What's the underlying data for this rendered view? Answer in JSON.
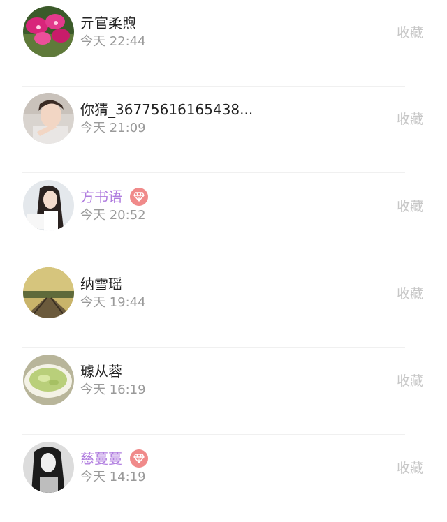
{
  "rows": [
    {
      "name": "亓官柔煦",
      "time": "今天 22:44",
      "action": "收藏",
      "vip": false,
      "avatar_icon": "orchid-flower-avatar"
    },
    {
      "name": "你猜_36775616165438...",
      "time": "今天 21:09",
      "action": "收藏",
      "vip": false,
      "avatar_icon": "young-man-avatar"
    },
    {
      "name": "方书语",
      "time": "今天 20:52",
      "action": "收藏",
      "vip": true,
      "avatar_icon": "long-hair-girl-avatar"
    },
    {
      "name": "纳雪瑶",
      "time": "今天 19:44",
      "action": "收藏",
      "vip": false,
      "avatar_icon": "railway-landscape-avatar"
    },
    {
      "name": "璩从蓉",
      "time": "今天 16:19",
      "action": "收藏",
      "vip": false,
      "avatar_icon": "green-soup-bowl-avatar"
    },
    {
      "name": "慈蔓蔓",
      "time": "今天 14:19",
      "action": "收藏",
      "vip": true,
      "avatar_icon": "black-white-girl-avatar"
    }
  ],
  "colors": {
    "name_normal": "#222222",
    "name_vip": "#b07ddf",
    "time": "#9a9a9a",
    "action": "#c7c7c7",
    "vip_badge": "#f08a8a"
  }
}
